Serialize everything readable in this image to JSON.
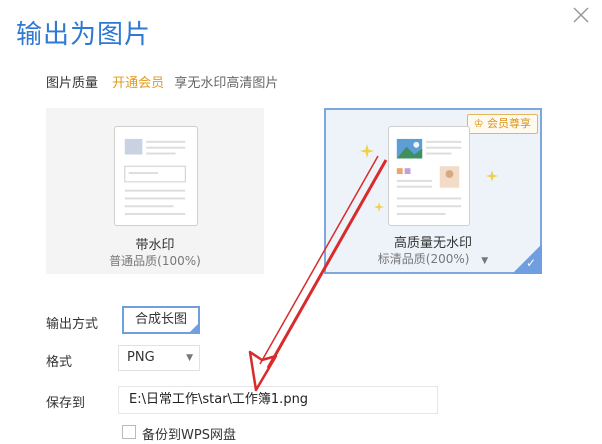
{
  "dialog": {
    "title": "输出为图片"
  },
  "quality": {
    "label": "图片质量",
    "vip_link": "开通会员",
    "vip_desc": "享无水印高清图片",
    "options": [
      {
        "name": "带水印",
        "sub": "普通品质(100%)"
      },
      {
        "name": "高质量无水印",
        "sub": "标清品质(200%)",
        "badge": "会员尊享",
        "selected": true
      }
    ]
  },
  "output_mode": {
    "label": "输出方式",
    "value": "合成长图"
  },
  "format": {
    "label": "格式",
    "value": "PNG"
  },
  "save": {
    "label": "保存到",
    "path": "E:\\日常工作\\star\\工作簿1.png"
  },
  "backup": {
    "label": "备份到WPS网盘",
    "checked": false
  },
  "colors": {
    "accent": "#2f78d4",
    "selection": "#6f9fe0",
    "vip": "#e29a1b",
    "arrow": "#d92b2b"
  }
}
